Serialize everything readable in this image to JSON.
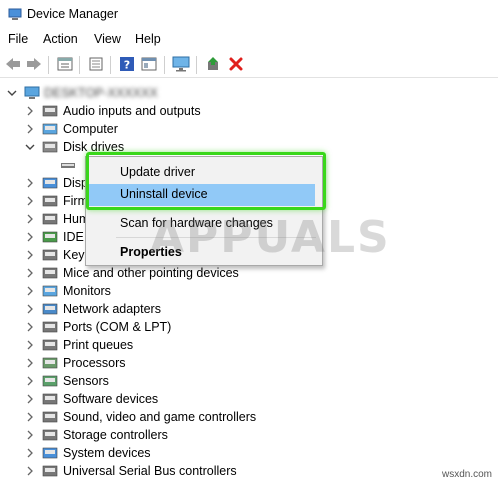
{
  "window": {
    "title": "Device Manager"
  },
  "menu": [
    "File",
    "Action",
    "View",
    "Help"
  ],
  "toolbar": {
    "icons": [
      "back-arrow-icon",
      "forward-arrow-icon",
      "properties-sheet-icon",
      "show-hidden-icon",
      "help-icon",
      "resources-icon",
      "monitor-scan-icon",
      "update-driver-icon",
      "uninstall-x-icon"
    ],
    "colors": {
      "uninstall": "#e0201c",
      "help": "#2f5bb7",
      "update": "#2e9b39"
    }
  },
  "tree": {
    "root": "DESKTOP-XXXXXX",
    "items": [
      {
        "label": "Audio inputs and outputs",
        "icon": "speaker-icon",
        "expanded": false
      },
      {
        "label": "Computer",
        "icon": "computer-icon",
        "expanded": false
      },
      {
        "label": "Disk drives",
        "icon": "disk-drive-icon",
        "expanded": true
      },
      {
        "label": "Disp",
        "icon": "display-adapter-icon",
        "expanded": false
      },
      {
        "label": "Firm",
        "icon": "firmware-icon",
        "expanded": false
      },
      {
        "label": "Hum",
        "icon": "hid-icon",
        "expanded": false
      },
      {
        "label": "IDE A",
        "icon": "ide-icon",
        "expanded": false
      },
      {
        "label": "Keyb",
        "icon": "keyboard-icon",
        "expanded": false
      },
      {
        "label": "Mice and other pointing devices",
        "icon": "mouse-icon",
        "expanded": false
      },
      {
        "label": "Monitors",
        "icon": "monitor-icon",
        "expanded": false
      },
      {
        "label": "Network adapters",
        "icon": "network-icon",
        "expanded": false
      },
      {
        "label": "Ports (COM & LPT)",
        "icon": "port-icon",
        "expanded": false
      },
      {
        "label": "Print queues",
        "icon": "printer-icon",
        "expanded": false
      },
      {
        "label": "Processors",
        "icon": "processor-icon",
        "expanded": false
      },
      {
        "label": "Sensors",
        "icon": "sensor-icon",
        "expanded": false
      },
      {
        "label": "Software devices",
        "icon": "software-device-icon",
        "expanded": false
      },
      {
        "label": "Sound, video and game controllers",
        "icon": "sound-icon",
        "expanded": false
      },
      {
        "label": "Storage controllers",
        "icon": "storage-icon",
        "expanded": false
      },
      {
        "label": "System devices",
        "icon": "system-device-icon",
        "expanded": false
      },
      {
        "label": "Universal Serial Bus controllers",
        "icon": "usb-icon",
        "expanded": false
      }
    ]
  },
  "context_menu": {
    "items": [
      "Update driver",
      "Uninstall device",
      "Scan for hardware changes",
      "Properties"
    ],
    "highlighted": "Uninstall device",
    "highlight_color": "#91c9f7",
    "outline_color": "#39d71a"
  },
  "watermark": "APPUALS",
  "footer": "wsxdn.com"
}
